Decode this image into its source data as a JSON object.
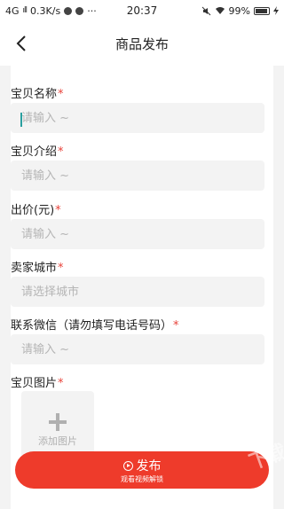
{
  "status_bar": {
    "network": "4G",
    "signal": "ıll",
    "speed": "0.3K/s",
    "more": "···",
    "time": "20:37",
    "battery_percent": "99%"
  },
  "header": {
    "title": "商品发布"
  },
  "form": {
    "fields": [
      {
        "label": "宝贝名称",
        "required": "*",
        "placeholder": "请输入 ~"
      },
      {
        "label": "宝贝介绍",
        "required": "*",
        "placeholder": "请输入 ~"
      },
      {
        "label": "出价(元)",
        "required": "*",
        "placeholder": "请输入 ~"
      },
      {
        "label": "卖家城市",
        "required": "*",
        "placeholder": "请选择城市"
      },
      {
        "label": "联系微信（请勿填写电话号码）",
        "required": "*",
        "placeholder": "请输入 ~"
      }
    ],
    "image": {
      "label": "宝贝图片",
      "required": "*",
      "add_label": "添加图片"
    }
  },
  "publish": {
    "label": "发布",
    "sublabel": "观看视频解锁"
  },
  "watermark": "下载"
}
